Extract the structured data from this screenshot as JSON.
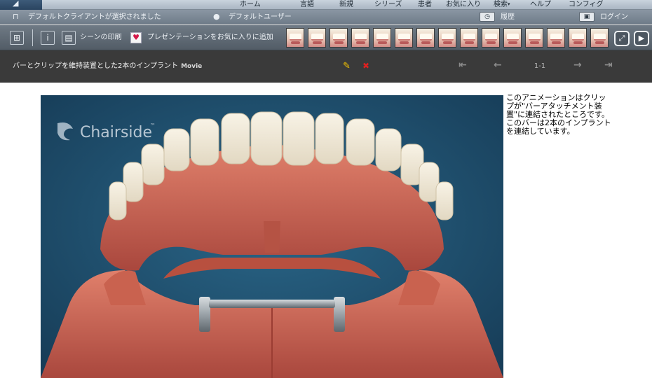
{
  "menu": {
    "items": [
      "ホーム",
      "言語",
      "新規",
      "シリーズ",
      "患者",
      "お気に入り",
      "検索",
      "ヘルプ",
      "コンフィグ"
    ]
  },
  "status": {
    "client": "デフォルトクライアントが選択されました",
    "user": "デフォルトユーザー",
    "history": "履歴",
    "login": "ログイン"
  },
  "toolbar": {
    "print_label": "シーンの印刷",
    "favorite_label": "プレゼンテーションをお気に入りに追加",
    "thumbnail_icons": [
      "scene-thumb-1-icon",
      "scene-thumb-2-icon",
      "scene-thumb-3-icon",
      "scene-thumb-4-icon",
      "scene-thumb-5-icon",
      "scene-thumb-6-icon",
      "scene-thumb-7-icon",
      "scene-thumb-8-icon",
      "scene-thumb-9-icon",
      "scene-thumb-10-icon",
      "scene-thumb-11-icon",
      "scene-thumb-12-icon",
      "scene-thumb-13-icon",
      "scene-thumb-14-icon",
      "scene-thumb-15-icon"
    ]
  },
  "titlebar": {
    "title": "バーとクリップを維持装置とした2本のインプラント",
    "badge": "Movie",
    "pager": "1-1"
  },
  "media": {
    "watermark": "Chairside",
    "trademark": "™"
  },
  "description": "このアニメーションはクリップが\"バーアタッチメント装置\"に連結されたところです。このバーは2本のインプラントを連結しています。",
  "colors": {
    "accent_edit": "#f5c400",
    "accent_delete": "#e02020",
    "media_background": "#1f4f6e"
  }
}
